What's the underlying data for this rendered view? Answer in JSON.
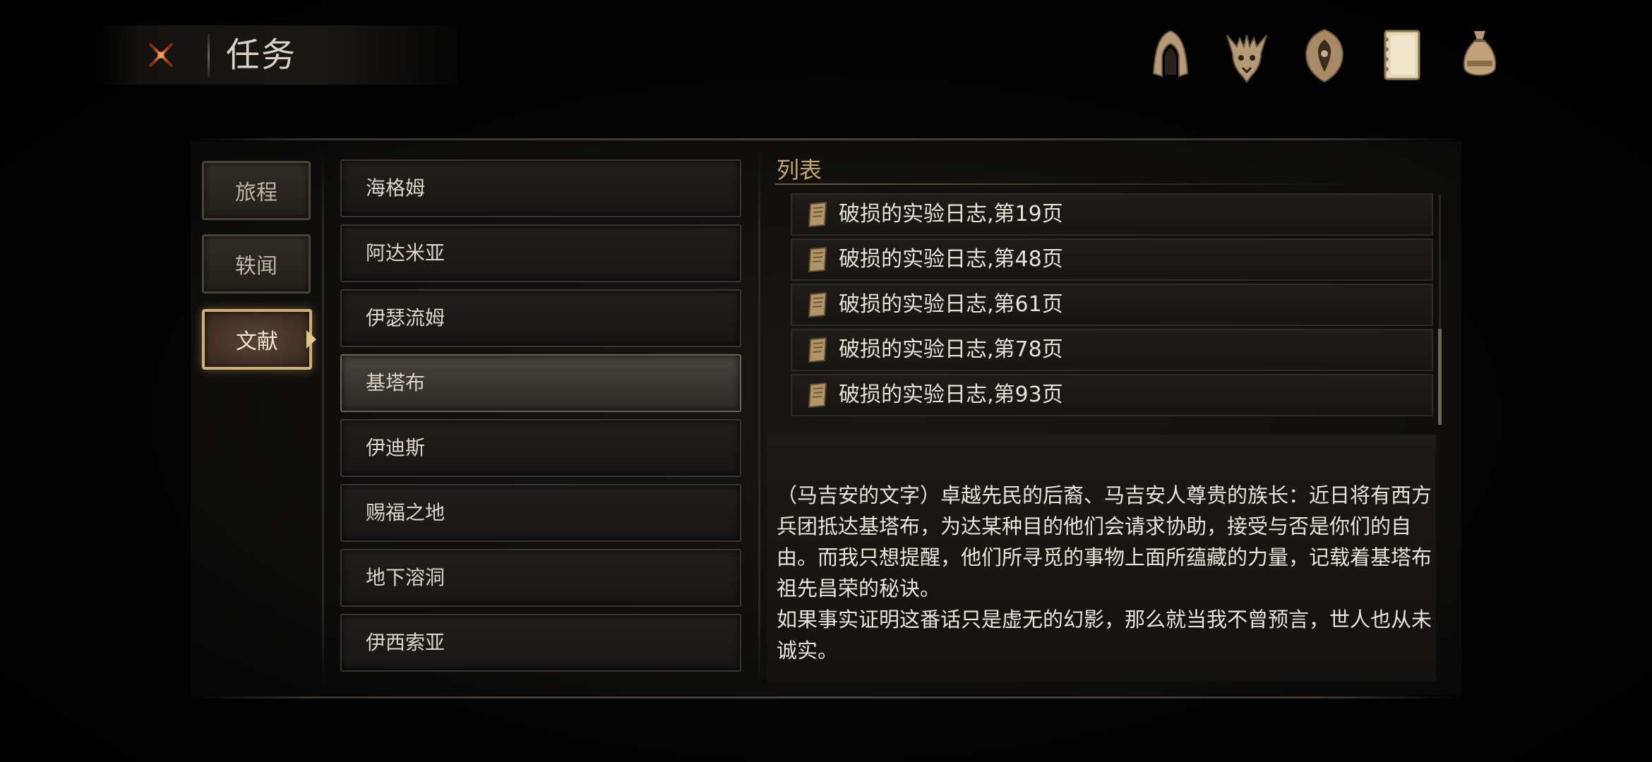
{
  "header": {
    "title": "任务",
    "close_icon": "close-x-icon",
    "nav_icons": [
      {
        "name": "hood-icon"
      },
      {
        "name": "beast-skull-icon"
      },
      {
        "name": "shield-emblem-icon"
      },
      {
        "name": "journal-icon"
      },
      {
        "name": "pouch-icon"
      }
    ]
  },
  "tabs": [
    {
      "label": "旅程",
      "active": false
    },
    {
      "label": "轶闻",
      "active": false
    },
    {
      "label": "文献",
      "active": true
    }
  ],
  "regions": [
    {
      "label": "海格姆",
      "selected": false
    },
    {
      "label": "阿达米亚",
      "selected": false
    },
    {
      "label": "伊瑟流姆",
      "selected": false
    },
    {
      "label": "基塔布",
      "selected": true
    },
    {
      "label": "伊迪斯",
      "selected": false
    },
    {
      "label": "赐福之地",
      "selected": false
    },
    {
      "label": "地下溶洞",
      "selected": false
    },
    {
      "label": "伊西索亚",
      "selected": false
    }
  ],
  "list": {
    "heading": "列表",
    "items": [
      {
        "label": "破损的实验日志,第19页",
        "icon": "scroll-icon"
      },
      {
        "label": "破损的实验日志,第48页",
        "icon": "scroll-icon"
      },
      {
        "label": "破损的实验日志,第61页",
        "icon": "scroll-icon"
      },
      {
        "label": "破损的实验日志,第78页",
        "icon": "scroll-icon"
      },
      {
        "label": "破损的实验日志,第93页",
        "icon": "scroll-icon"
      }
    ]
  },
  "description": {
    "text": "（马吉安的文字）卓越先民的后裔、马吉安人尊贵的族长：近日将有西方兵团抵达基塔布，为达某种目的他们会请求协助，接受与否是你们的自由。而我只想提醒，他们所寻觅的事物上面所蕴藏的力量，记载着基塔布祖先昌荣的秘诀。\n如果事实证明这番话只是虚无的幻影，那么就当我不曾预言，世人也从未诚实。"
  },
  "colors": {
    "accent_gold": "#cdb178",
    "close_orange": "#e0632a",
    "heading_gold": "#c6a56c"
  }
}
